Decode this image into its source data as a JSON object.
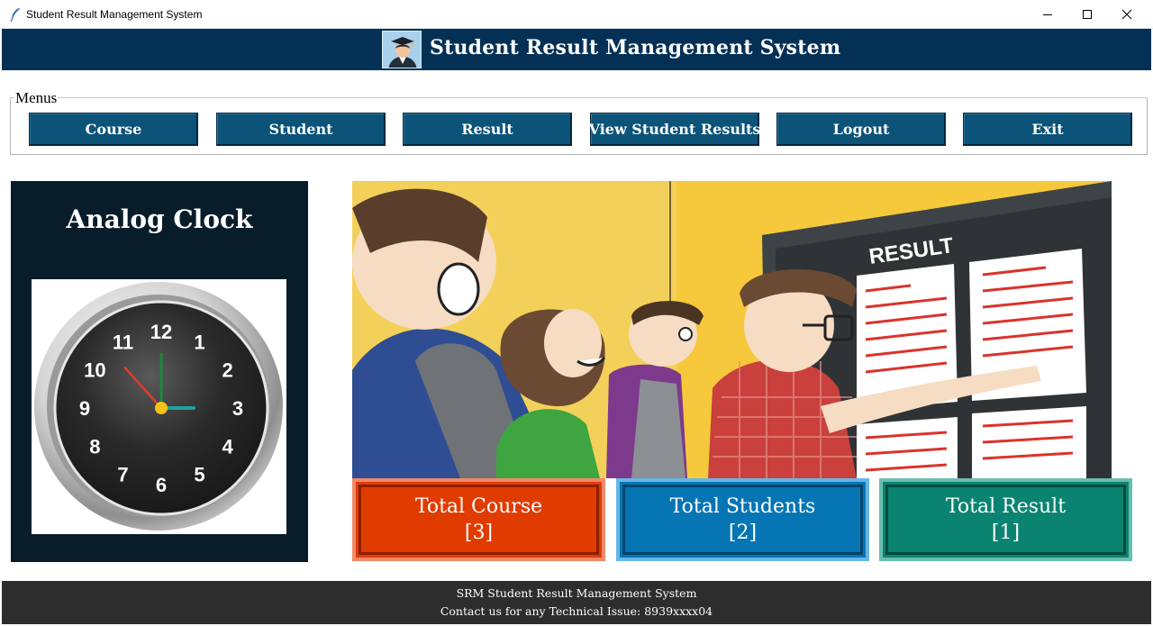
{
  "window": {
    "title": "Student Result Management System"
  },
  "header": {
    "title": "Student Result Management System",
    "logo_icon": "graduate-avatar-icon"
  },
  "menus": {
    "label": "Menus",
    "items": [
      {
        "label": "Course"
      },
      {
        "label": "Student"
      },
      {
        "label": "Result"
      },
      {
        "label": "View Student Results"
      },
      {
        "label": "Logout"
      },
      {
        "label": "Exit"
      }
    ]
  },
  "clock": {
    "title": "Analog Clock",
    "numerals": [
      "12",
      "1",
      "2",
      "3",
      "4",
      "5",
      "6",
      "7",
      "8",
      "9",
      "10",
      "11"
    ],
    "time": {
      "hour": 3,
      "minute": 0,
      "second": 53
    }
  },
  "banner": {
    "sign_text": "RESULT"
  },
  "stats": [
    {
      "label": "Total Course",
      "value": "[3]",
      "color": "#e03c00",
      "border": "#f08968",
      "inner": "#8a1f00"
    },
    {
      "label": "Total Students",
      "value": "[2]",
      "color": "#0575b3",
      "border": "#68b6e6",
      "inner": "#03456b"
    },
    {
      "label": "Total Result",
      "value": "[1]",
      "color": "#0a8470",
      "border": "#6bbdaf",
      "inner": "#04493d"
    }
  ],
  "footer": {
    "line1": "SRM Student Result Management System",
    "line2": "Contact us for any Technical Issue: 8939xxxx04"
  },
  "colors": {
    "header_bg": "#033054",
    "menu_button": "#0b5378",
    "clock_panel": "#081c29",
    "footer_bg": "#2d2d2d"
  }
}
